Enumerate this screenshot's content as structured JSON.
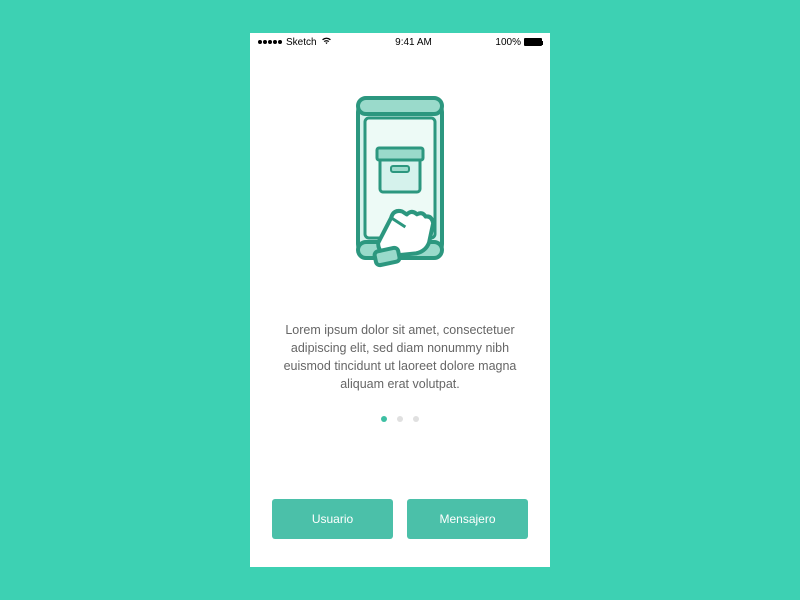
{
  "status_bar": {
    "carrier": "Sketch",
    "time": "9:41 AM",
    "battery_percent": "100%"
  },
  "onboarding": {
    "description": "Lorem ipsum dolor sit amet, consectetuer adipiscing elit, sed diam nonummy nibh euismod tincidunt ut laoreet dolore magna aliquam erat volutpat.",
    "pager": {
      "active_index": 0,
      "count": 3
    }
  },
  "buttons": {
    "left_label": "Usuario",
    "right_label": "Mensajero"
  },
  "icons": {
    "illustration": "phone-box-hand-icon",
    "wifi": "wifi-icon",
    "signal": "signal-dots-icon",
    "battery": "battery-icon"
  },
  "colors": {
    "background": "#3dd1b3",
    "accent": "#4bc0a9",
    "accent_dark": "#2c977f",
    "illustration_light": "#d5f2ec",
    "illustration_mid": "#9adacb"
  }
}
